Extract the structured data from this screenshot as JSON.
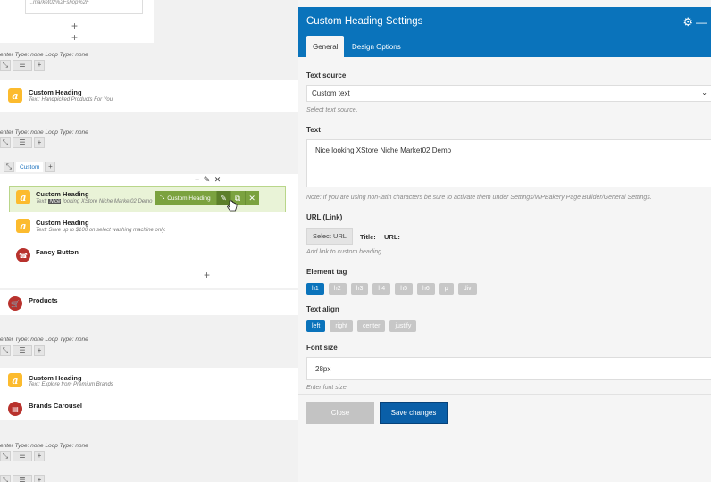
{
  "builder": {
    "code_snippet": "...market02%2Fshop%2F",
    "plus": "+",
    "type_line": "enter Type: none  Loop Type: none",
    "controls": {
      "move": "⤡",
      "columns": "☰",
      "add": "+"
    },
    "elements": [
      {
        "title": "Custom Heading",
        "subtitle": "Text: Handpicked Products For You",
        "icon": "a"
      },
      {
        "title": "Custom Heading",
        "subtitle_prefix": "Text: ",
        "subtitle_highlight": "Nice",
        "subtitle_rest": " looking XStore Niche Market02 Demo",
        "icon": "a"
      },
      {
        "title": "Custom Heading",
        "subtitle": "Text: Save up to $100 on select washing machine only.",
        "icon": "a"
      },
      {
        "title": "Fancy Button",
        "icon": "☎"
      },
      {
        "title": "Products",
        "icon": "🛒"
      },
      {
        "title": "Custom Heading",
        "subtitle": "Text: Explore from Premium Brands",
        "icon": "a"
      },
      {
        "title": "Brands Carousel",
        "icon": "▤"
      }
    ],
    "tab_label": "Custom",
    "row_tools": "+ ✎ ✕",
    "green_toolbar": {
      "label": "Custom Heading",
      "move": "⤡",
      "edit": "✎",
      "clone": "⧉",
      "delete": "✕"
    }
  },
  "panel": {
    "title": "Custom Heading Settings",
    "gear_icon": "⚙",
    "minimize_icon": "—",
    "tabs": [
      {
        "label": "General",
        "active": true
      },
      {
        "label": "Design Options",
        "active": false
      }
    ],
    "text_source": {
      "label": "Text source",
      "value": "Custom text",
      "help": "Select text source."
    },
    "text": {
      "label": "Text",
      "value": "Nice looking XStore Niche Market02 Demo",
      "help": "Note: If you are using non-latin characters be sure to activate them under Settings/WPBakery Page Builder/General Settings."
    },
    "url": {
      "label": "URL (Link)",
      "button": "Select URL",
      "title_label": "Title:",
      "url_label": "URL:",
      "help": "Add link to custom heading."
    },
    "element_tag": {
      "label": "Element tag",
      "options": [
        "h1",
        "h2",
        "h3",
        "h4",
        "h5",
        "h6",
        "p",
        "div"
      ],
      "selected": "h1"
    },
    "text_align": {
      "label": "Text align",
      "options": [
        "left",
        "right",
        "center",
        "justify"
      ],
      "selected": "left"
    },
    "font_size": {
      "label": "Font size",
      "value": "28px",
      "help": "Enter font size."
    },
    "footer": {
      "close": "Close",
      "save": "Save changes"
    }
  },
  "colors": {
    "accent": "#0a73bb",
    "save": "#0a5fa8",
    "heading_icon": "#fcbb2e",
    "green": "#7ba23f"
  }
}
